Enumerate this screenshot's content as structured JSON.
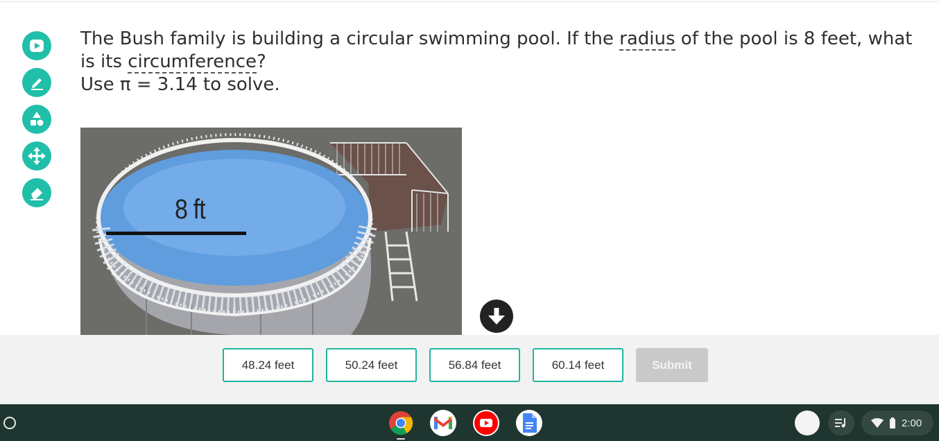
{
  "tools": [
    {
      "name": "play-icon",
      "label": "play"
    },
    {
      "name": "pencil-icon",
      "label": "pencil"
    },
    {
      "name": "shapes-icon",
      "label": "shapes"
    },
    {
      "name": "move-icon",
      "label": "move"
    },
    {
      "name": "eraser-icon",
      "label": "eraser"
    }
  ],
  "question": {
    "part1": "The Bush family is building a circular swimming pool. If the ",
    "term1": "radius",
    "part2": " of the pool is 8 feet, what is its ",
    "term2": "circumference",
    "part3": "?",
    "line2": "Use π = 3.14 to solve."
  },
  "image": {
    "label": "8 ft"
  },
  "answers": {
    "choices": [
      "48.24 feet",
      "50.24 feet",
      "56.84 feet",
      "60.14 feet"
    ],
    "submit_label": "Submit"
  },
  "shelf": {
    "apps": [
      "chrome-icon",
      "gmail-icon",
      "youtube-icon",
      "docs-icon"
    ],
    "time": "2:00"
  },
  "colors": {
    "accent": "#1fbfa9",
    "shelf": "#1f3530",
    "submit_disabled": "#c9c9c9"
  }
}
